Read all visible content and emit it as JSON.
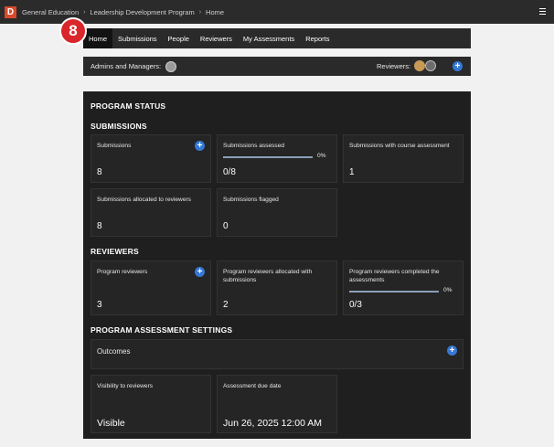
{
  "topbar": {
    "logo": "D",
    "breadcrumb": [
      "General Education",
      "Leadership Development Program",
      "Home"
    ]
  },
  "step_badge": "8",
  "nav": {
    "tabs": [
      "Home",
      "Submissions",
      "People",
      "Reviewers",
      "My Assessments",
      "Reports"
    ],
    "active": "Home"
  },
  "admins_bar": {
    "admins_label": "Admins and Managers:",
    "reviewers_label": "Reviewers:"
  },
  "program": {
    "title": "PROGRAM STATUS",
    "submissions": {
      "heading": "SUBMISSIONS",
      "cards": [
        {
          "title": "Submissions",
          "value": "8"
        },
        {
          "title": "Submissions assessed",
          "value": "0/8",
          "progress": "0%"
        },
        {
          "title": "Submissions with course assessment",
          "value": "1"
        },
        {
          "title": "Submissions allocated to reviewers",
          "value": "8"
        },
        {
          "title": "Submissions flagged",
          "value": "0"
        }
      ]
    },
    "reviewers": {
      "heading": "REVIEWERS",
      "cards": [
        {
          "title": "Program reviewers",
          "value": "3"
        },
        {
          "title": "Program reviewers allocated with submissions",
          "value": "2"
        },
        {
          "title": "Program reviewers completed the assessments",
          "value": "0/3",
          "progress": "0%"
        }
      ]
    },
    "settings": {
      "heading": "PROGRAM ASSESSMENT SETTINGS",
      "outcomes": "Outcomes",
      "cards": [
        {
          "title": "Visibility to reviewers",
          "value": "Visible"
        },
        {
          "title": "Assessment due date",
          "value": "Jun 26, 2025 12:00 AM"
        }
      ]
    }
  },
  "colors": {
    "accent": "#3577d4",
    "badge": "#d9262b",
    "logo": "#d84a2b"
  }
}
